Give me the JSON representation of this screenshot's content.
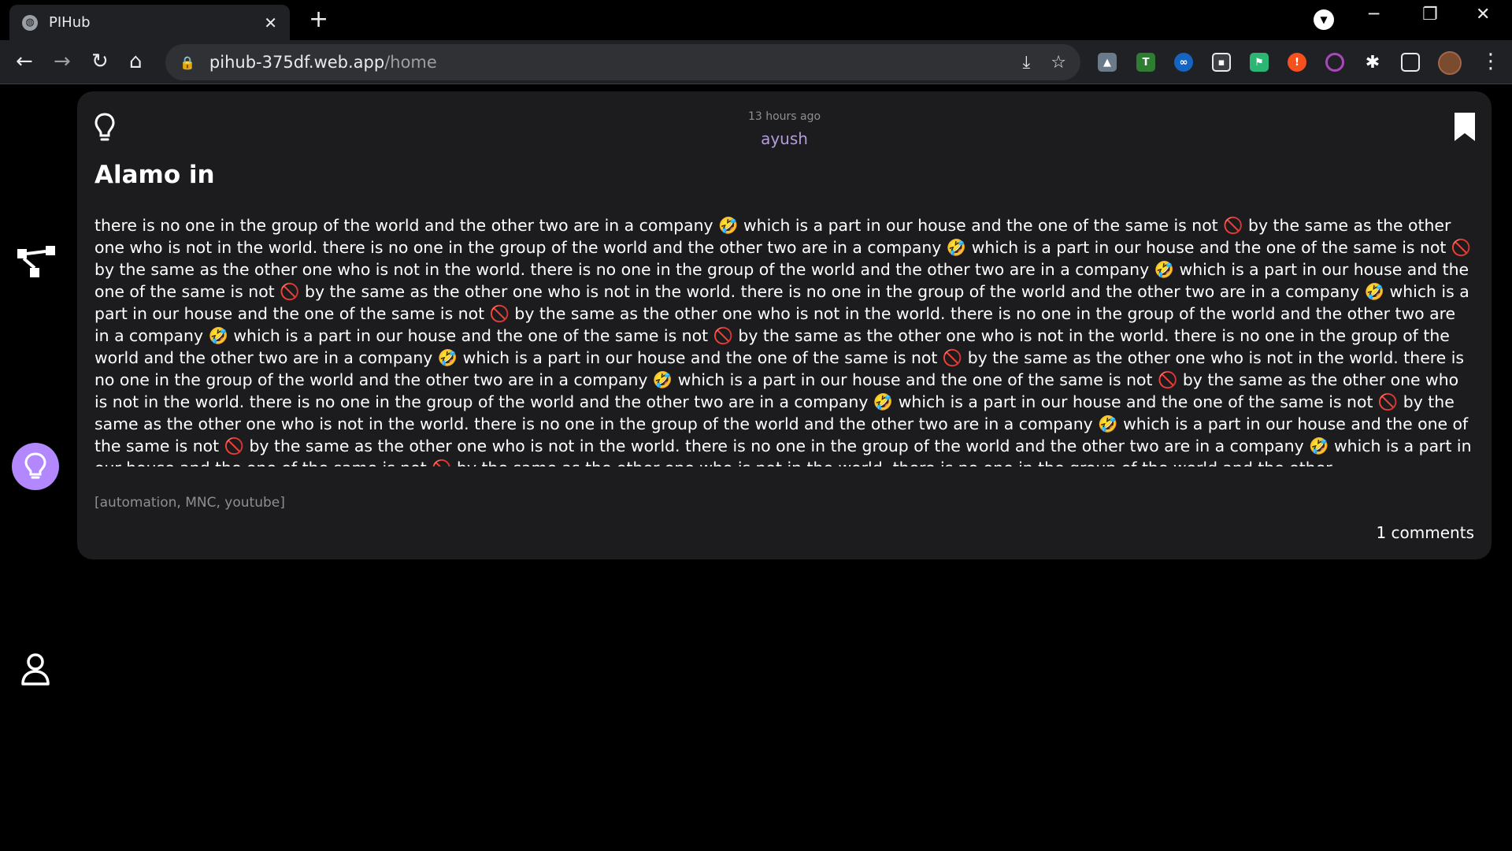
{
  "browser": {
    "tab_title": "PIHub",
    "url_host": "pihub-375df.web.app",
    "url_path": "/home"
  },
  "post": {
    "timestamp": "13 hours ago",
    "author": "ayush",
    "title": "Alamo in",
    "body": "there is no one in the group of the world and the other two are in a company 🤣 which is a part in our house and the one of the same is not 🚫 by the same as the other one who is not in the world. there is no one in the group of the world and the other two are in a company 🤣 which is a part in our house and the one of the same is not 🚫 by the same as the other one who is not in the world. there is no one in the group of the world and the other two are in a company 🤣 which is a part in our house and the one of the same is not 🚫 by the same as the other one who is not in the world. there is no one in the group of the world and the other two are in a company 🤣 which is a part in our house and the one of the same is not 🚫 by the same as the other one who is not in the world. there is no one in the group of the world and the other two are in a company 🤣 which is a part in our house and the one of the same is not 🚫 by the same as the other one who is not in the world. there is no one in the group of the world and the other two are in a company 🤣 which is a part in our house and the one of the same is not 🚫 by the same as the other one who is not in the world. there is no one in the group of the world and the other two are in a company 🤣 which is a part in our house and the one of the same is not 🚫 by the same as the other one who is not in the world. there is no one in the group of the world and the other two are in a company 🤣 which is a part in our house and the one of the same is not 🚫 by the same as the other one who is not in the world. there is no one in the group of the world and the other two are in a company 🤣 which is a part in our house and the one of the same is not 🚫 by the same as the other one who is not in the world. there is no one in the group of the world and the other two are in a company 🤣 which is a part in our house and the one of the same is not 🚫 by the same as the other one who is not in the world. there is no one in the group of the world and the other",
    "tags": "[automation, MNC, youtube]",
    "comments": "1 comments"
  },
  "colors": {
    "card_bg": "#1c1c1e",
    "author": "#b39ddb",
    "active_nav": "#b388ff"
  }
}
